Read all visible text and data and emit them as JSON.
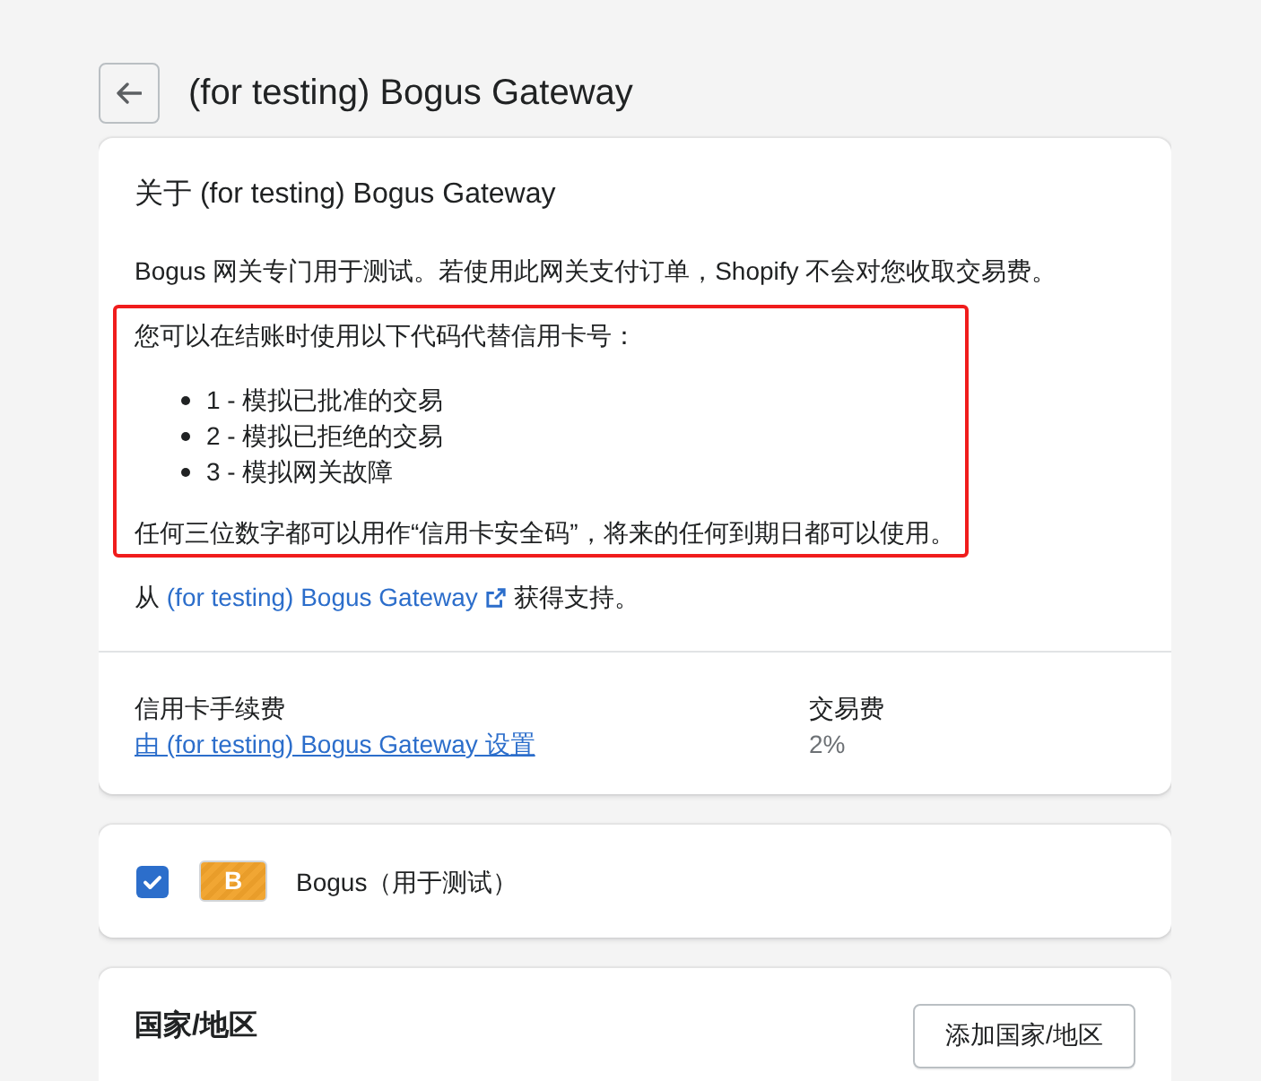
{
  "header": {
    "title": "(for testing) Bogus Gateway"
  },
  "about_card": {
    "heading": "关于 (for testing) Bogus Gateway",
    "description": "Bogus 网关专门用于测试。若使用此网关支付订单，Shopify 不会对您收取交易费。",
    "instructions": {
      "highlighted": true,
      "intro": "您可以在结账时使用以下代码代替信用卡号：",
      "codes": [
        "1 - 模拟已批准的交易",
        "2 - 模拟已拒绝的交易",
        "3 - 模拟网关故障"
      ],
      "note": "任何三位数字都可以用作“信用卡安全码”，将来的任何到期日都可以使用。"
    },
    "support": {
      "prefix": "从",
      "link": "(for testing) Bogus Gateway",
      "suffix": "获得支持。"
    },
    "fees": [
      {
        "kind": "link",
        "label": "信用卡手续费",
        "value": "由 (for testing) Bogus Gateway 设置"
      },
      {
        "kind": "text",
        "label": "交易费",
        "value": "2%"
      }
    ]
  },
  "method_card": {
    "checked": true,
    "logo_letter": "B",
    "name": "Bogus（用于测试）"
  },
  "regions_card": {
    "heading": "国家/地区",
    "add_button": "添加国家/地区"
  }
}
